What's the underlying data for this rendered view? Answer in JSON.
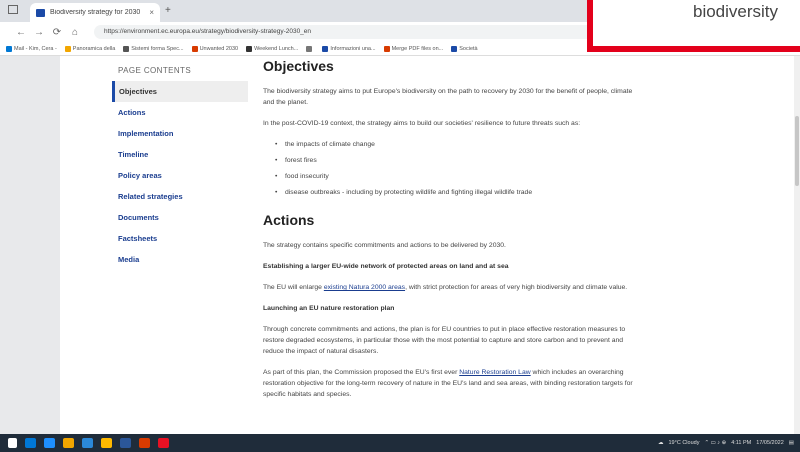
{
  "browser": {
    "tab_title": "Biodiversity strategy for 2030",
    "tab_close": "×",
    "new_tab": "+",
    "url": "https://environment.ec.europa.eu/strategy/biodiversity-strategy-2030_en",
    "nav": {
      "back": "←",
      "forward": "→",
      "reload": "⟳",
      "home": "⌂"
    },
    "bookmarks": [
      {
        "label": "Mail - Kim, Cera -",
        "color": "#0078d4"
      },
      {
        "label": "Panoramica della",
        "color": "#f2a600"
      },
      {
        "label": "Sistemi forma Spec...",
        "color": "#555555"
      },
      {
        "label": "Unwanted 2030",
        "color": "#d83b01"
      },
      {
        "label": "Weekend Lunch...",
        "color": "#333333"
      },
      {
        "label": "",
        "color": "#777777"
      },
      {
        "label": "Informazioni una...",
        "color": "#1b4aa7"
      },
      {
        "label": "Merge PDF files on...",
        "color": "#d83b01"
      },
      {
        "label": "Società",
        "color": "#1b4aa7"
      }
    ]
  },
  "overlay": {
    "text": "biodiversity"
  },
  "toc": {
    "title": "PAGE CONTENTS",
    "items": [
      {
        "label": "Objectives",
        "active": true
      },
      {
        "label": "Actions"
      },
      {
        "label": "Implementation"
      },
      {
        "label": "Timeline"
      },
      {
        "label": "Policy areas"
      },
      {
        "label": "Related strategies"
      },
      {
        "label": "Documents"
      },
      {
        "label": "Factsheets"
      },
      {
        "label": "Media"
      }
    ]
  },
  "content": {
    "objectives_heading": "Objectives",
    "obj_p1": "The biodiversity strategy aims to put Europe's biodiversity on the path to recovery by 2030 for the benefit of people, climate and the planet.",
    "obj_p2": "In the post-COVID-19 context, the strategy aims to build our societies' resilience to future threats such as:",
    "threats": [
      "the impacts of climate change",
      "forest fires",
      "food insecurity",
      "disease outbreaks - including by protecting wildlife and fighting illegal wildlife trade"
    ],
    "actions_heading": "Actions",
    "act_p1": "The strategy contains specific commitments and actions to be delivered by 2030.",
    "act_h1": "Establishing a larger EU-wide network of protected areas on land and at sea",
    "act_p2_pre": "The EU will enlarge ",
    "act_p2_link": "existing Natura 2000 areas",
    "act_p2_post": ", with strict protection for areas of very high biodiversity and climate value.",
    "act_h2": "Launching an EU nature restoration plan",
    "act_p3": "Through concrete commitments and actions, the plan is for EU countries to put in place effective restoration measures to restore degraded ecosystems, in particular those with the most potential to capture and store carbon and to prevent and reduce the impact of natural disasters.",
    "act_p4_pre": "As part of this plan, the Commission proposed the EU's first ever ",
    "act_p4_link": "Nature Restoration Law",
    "act_p4_post": " which includes an overarching restoration objective for the long-term recovery of nature in the EU's land and sea areas, with binding restoration targets for specific habitats and species."
  },
  "taskbar": {
    "icons": [
      "#0078d7",
      "#1e90ff",
      "#f2a600",
      "#2b88d8",
      "#ffb900",
      "#2b579a",
      "#d83b01",
      "#e81123"
    ],
    "weather": "19°C Cloudy",
    "time": "4:11 PM",
    "date": "17/05/2022"
  }
}
